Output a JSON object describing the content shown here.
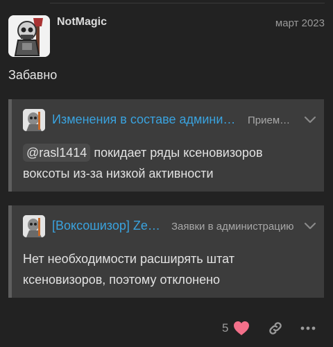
{
  "post": {
    "username": "NotMagic",
    "date": "март 2023",
    "text": "Забавно"
  },
  "quotes": [
    {
      "title": "Изменения в составе администрации",
      "category": "Приемная",
      "mention": "@rasl1414",
      "body": "покидает ряды ксеновизоров воксоты из-за низкой активности"
    },
    {
      "title": "[Воксошизор] Zeneca",
      "category": "Заявки в администрацию",
      "body": "Нет необходимости расширять штат ксеновизоров, поэтому отклонено"
    }
  ],
  "actions": {
    "like_count": "5"
  },
  "colors": {
    "background": "#222222",
    "quote_bg": "#3c3c3c",
    "link": "#3aa3df",
    "heart": "#f3708a"
  },
  "icons": [
    "heart-icon",
    "link-icon",
    "more-icon",
    "chevron-down-icon"
  ]
}
